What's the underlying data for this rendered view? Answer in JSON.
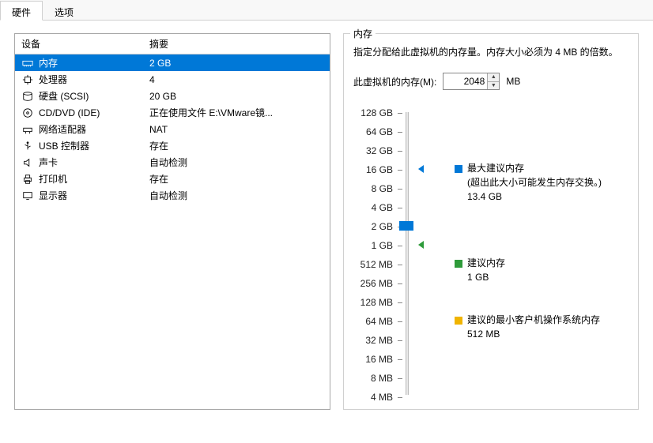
{
  "tabs": {
    "hardware": "硬件",
    "options": "选项"
  },
  "headers": {
    "device": "设备",
    "summary": "摘要"
  },
  "devices": [
    {
      "icon": "memory-icon",
      "name": "内存",
      "summary": "2 GB",
      "selected": true
    },
    {
      "icon": "cpu-icon",
      "name": "处理器",
      "summary": "4"
    },
    {
      "icon": "disk-icon",
      "name": "硬盘 (SCSI)",
      "summary": "20 GB"
    },
    {
      "icon": "cd-icon",
      "name": "CD/DVD (IDE)",
      "summary": "正在使用文件 E:\\VMware镜..."
    },
    {
      "icon": "network-icon",
      "name": "网络适配器",
      "summary": "NAT"
    },
    {
      "icon": "usb-icon",
      "name": "USB 控制器",
      "summary": "存在"
    },
    {
      "icon": "sound-icon",
      "name": "声卡",
      "summary": "自动检测"
    },
    {
      "icon": "printer-icon",
      "name": "打印机",
      "summary": "存在"
    },
    {
      "icon": "display-icon",
      "name": "显示器",
      "summary": "自动检测"
    }
  ],
  "memory": {
    "group_title": "内存",
    "description": "指定分配给此虚拟机的内存量。内存大小必须为 4 MB 的倍数。",
    "label": "此虚拟机的内存(M):",
    "value": "2048",
    "unit": "MB",
    "scale": [
      "128 GB",
      "64 GB",
      "32 GB",
      "16 GB",
      "8 GB",
      "4 GB",
      "2 GB",
      "1 GB",
      "512 MB",
      "256 MB",
      "128 MB",
      "64 MB",
      "32 MB",
      "16 MB",
      "8 MB",
      "4 MB"
    ],
    "legends": {
      "max": {
        "title": "最大建议内存",
        "note": "(超出此大小可能发生内存交换。)",
        "value": "13.4 GB",
        "color": "#0078d7"
      },
      "rec": {
        "title": "建议内存",
        "value": "1 GB",
        "color": "#2e9b3a"
      },
      "min": {
        "title": "建议的最小客户机操作系统内存",
        "value": "512 MB",
        "color": "#f0b400"
      }
    }
  }
}
